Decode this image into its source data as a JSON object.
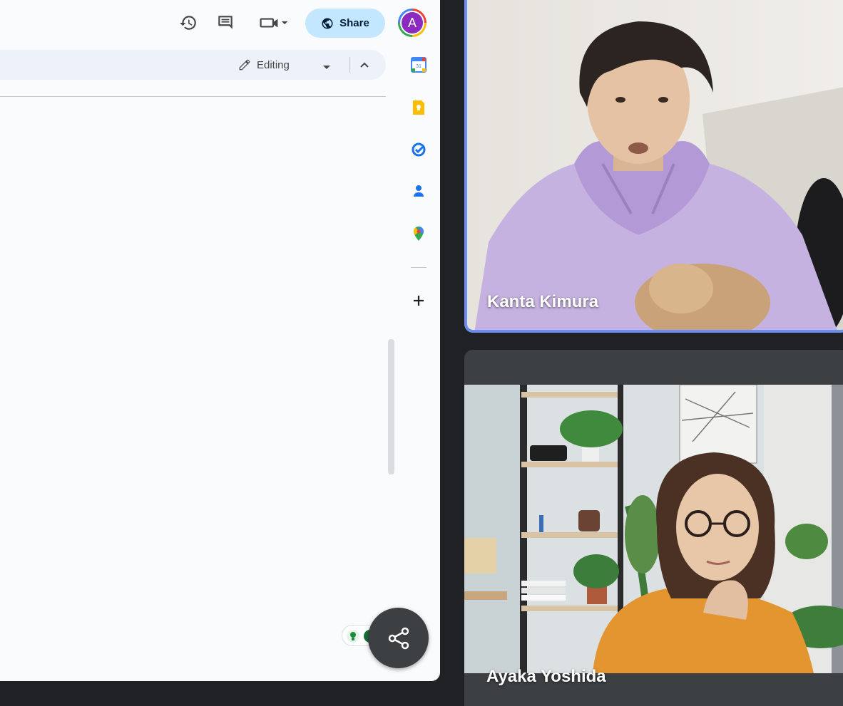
{
  "docs": {
    "toolbar": {
      "share_label": "Share",
      "avatar_initial": "A",
      "mode_label": "Editing"
    },
    "icons": [
      "history-icon",
      "comment-icon",
      "meet-icon",
      "globe-icon",
      "pencil-icon"
    ],
    "side_panel": [
      "calendar-icon",
      "keep-icon",
      "tasks-icon",
      "contacts-icon",
      "maps-icon",
      "add-icon"
    ]
  },
  "meet": {
    "participants": [
      {
        "name": "Kanta Kimura",
        "active_speaker": true
      },
      {
        "name": "Ayaka Yoshida",
        "active_speaker": false
      }
    ]
  },
  "colors": {
    "share_button": "#c2e7ff",
    "avatar": "#8b2bbf",
    "active_speaker_border": "#6c8ef1",
    "meet_background": "#202124"
  }
}
